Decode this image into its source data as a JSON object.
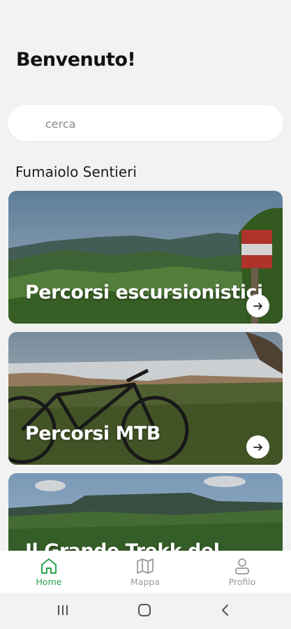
{
  "header": {
    "title": "Benvenuto!"
  },
  "search": {
    "placeholder": "cerca",
    "value": ""
  },
  "section": {
    "title": "Fumaiolo Sentieri"
  },
  "cards": [
    {
      "label": "Percorsi escursionistici",
      "icon": "arrow-right-icon"
    },
    {
      "label": "Percorsi MTB",
      "icon": "arrow-right-icon"
    },
    {
      "label": "Il Grande Trekk del",
      "icon": "arrow-right-icon"
    }
  ],
  "bottom_nav": {
    "items": [
      {
        "label": "Home",
        "icon": "home-icon",
        "active": true
      },
      {
        "label": "Mappa",
        "icon": "map-icon",
        "active": false
      },
      {
        "label": "Profilo",
        "icon": "user-icon",
        "active": false
      }
    ]
  },
  "colors": {
    "accent": "#27a64b",
    "inactive": "#9a9a9a",
    "background": "#f2f2f2"
  }
}
